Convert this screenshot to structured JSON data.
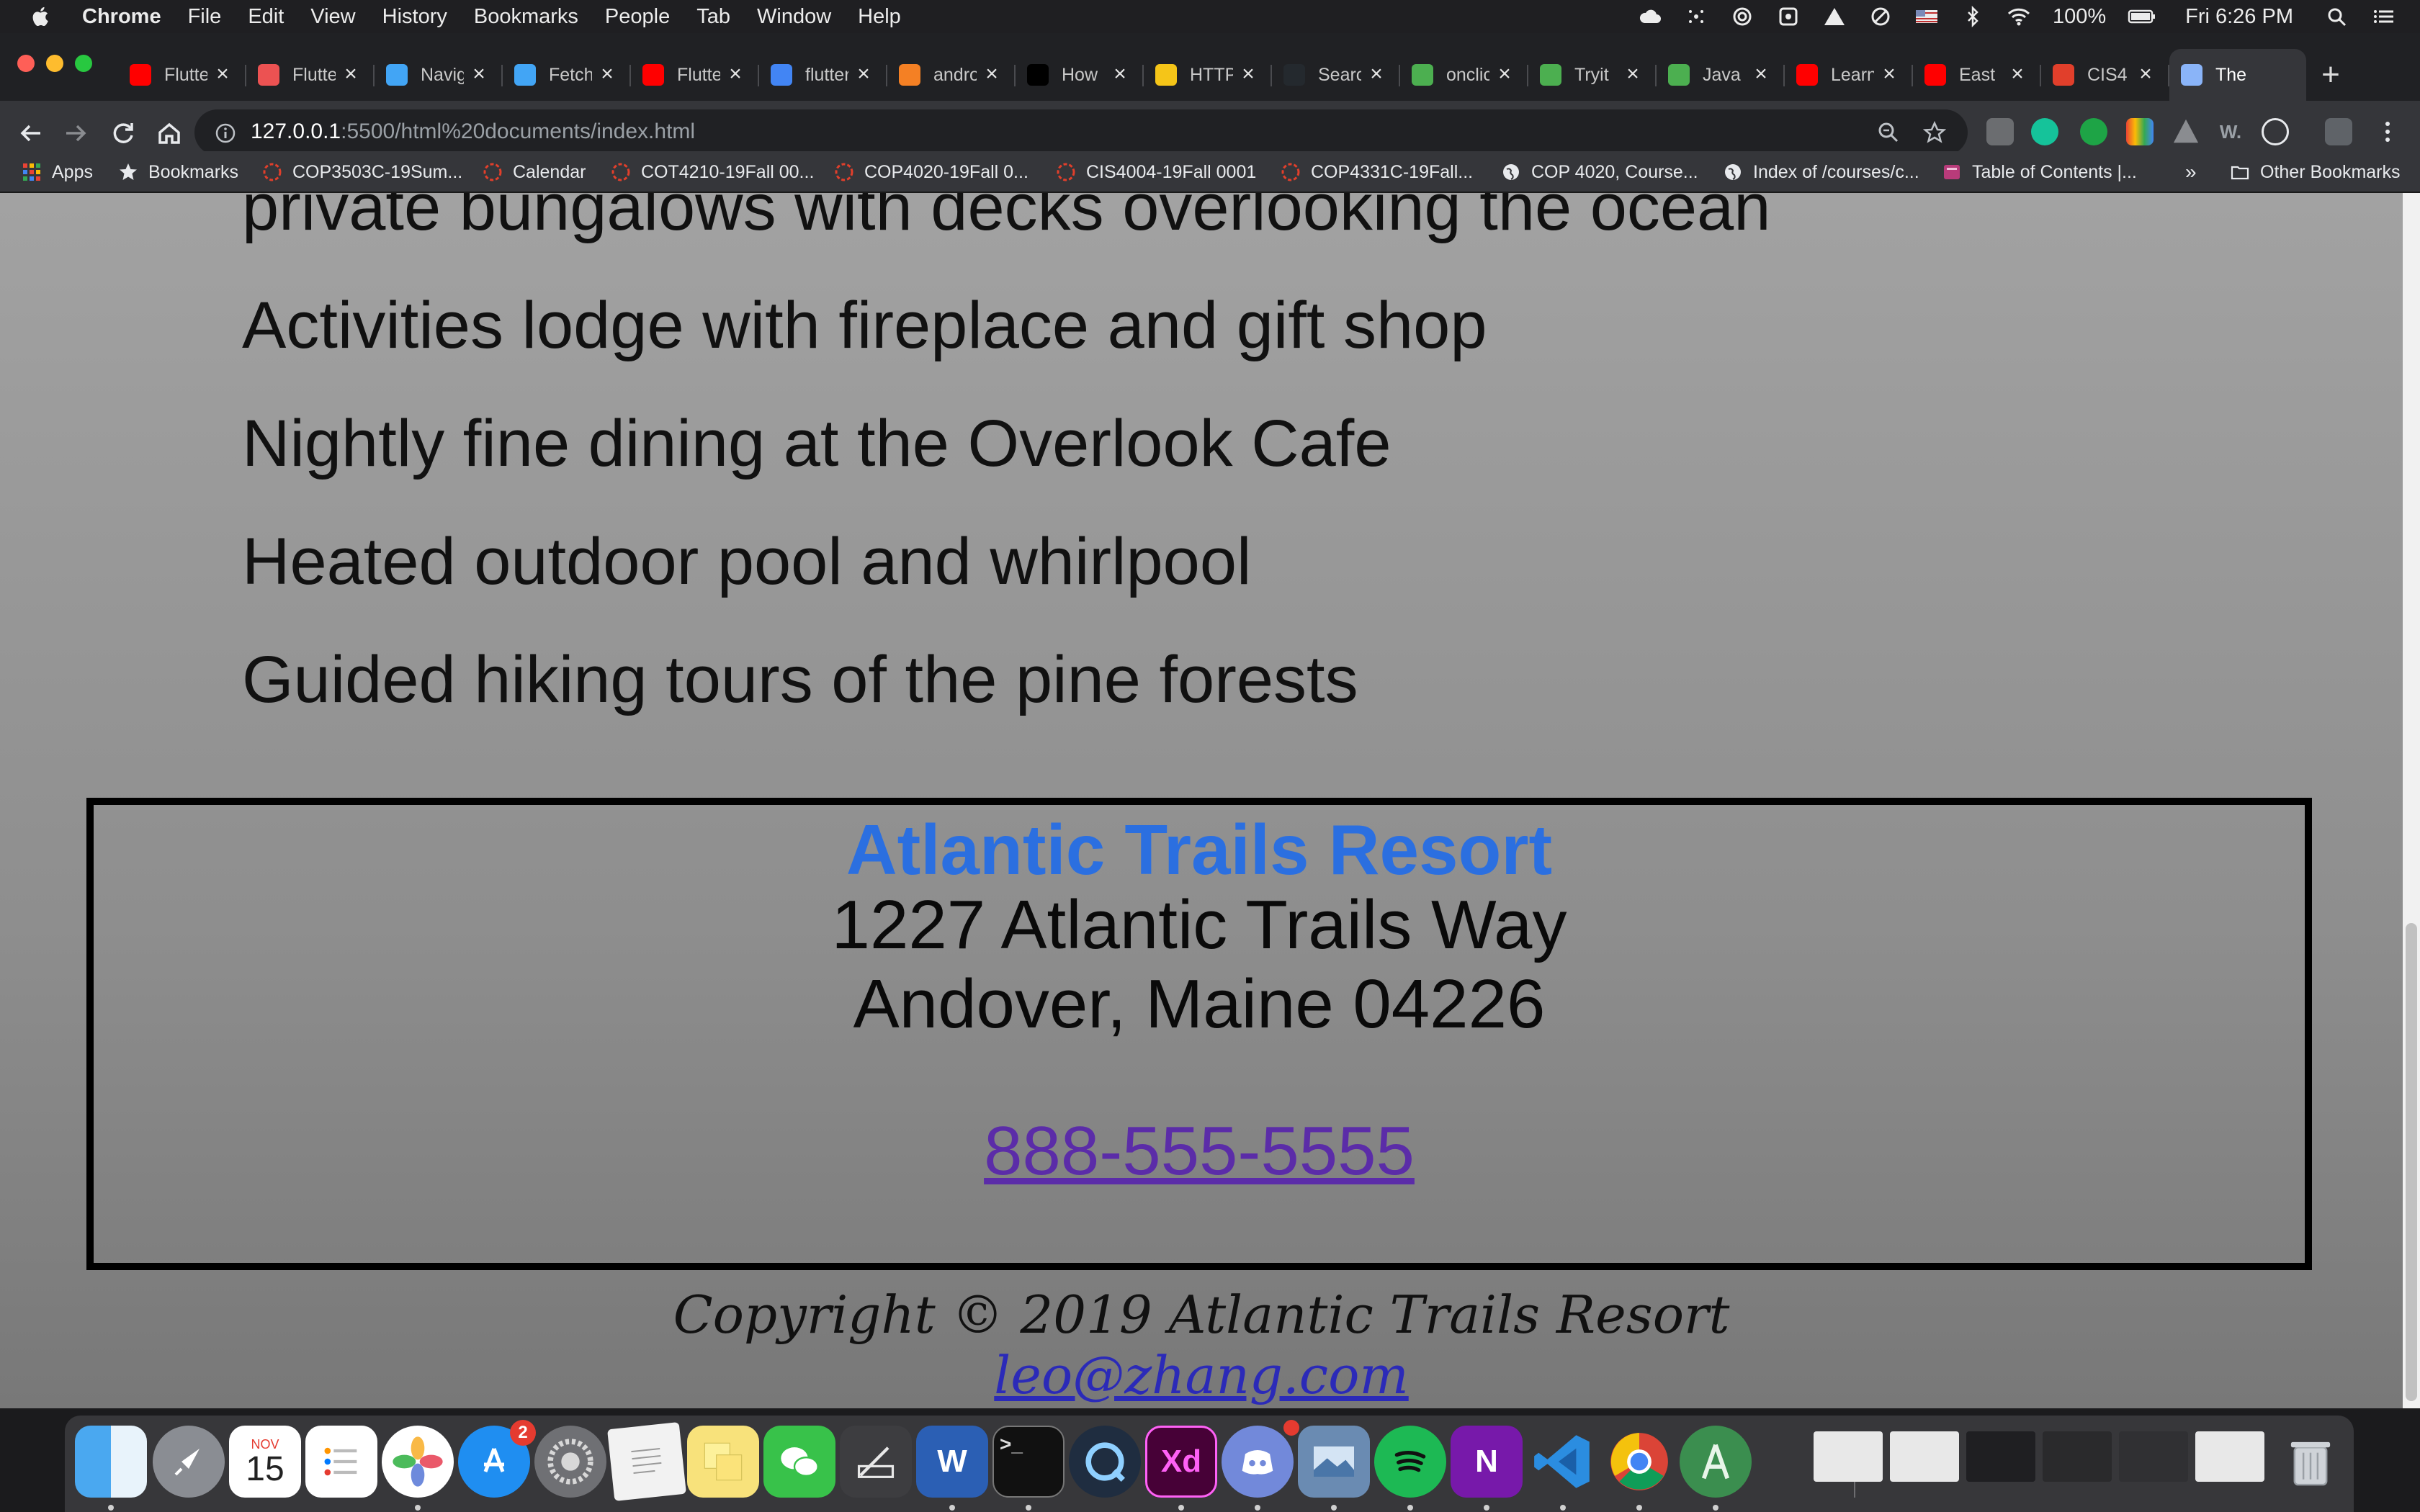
{
  "menubar": {
    "app_name": "Chrome",
    "menus": [
      "File",
      "Edit",
      "View",
      "History",
      "Bookmarks",
      "People",
      "Tab",
      "Window",
      "Help"
    ],
    "battery": "100%",
    "clock": "Fri 6:26 PM"
  },
  "tabs": [
    {
      "title": "Flutter",
      "icon": "youtube-icon",
      "color": "#ff0000"
    },
    {
      "title": "Flutter",
      "icon": "udemy-icon",
      "color": "#ec5252"
    },
    {
      "title": "Navigation",
      "icon": "flutter-icon",
      "color": "#42a5f5"
    },
    {
      "title": "Fetch",
      "icon": "flutter-icon",
      "color": "#42a5f5"
    },
    {
      "title": "Flutter",
      "icon": "youtube-icon",
      "color": "#ff0000"
    },
    {
      "title": "flutter",
      "icon": "google-icon",
      "color": "#4285f4"
    },
    {
      "title": "android",
      "icon": "stackoverflow-icon",
      "color": "#f48024"
    },
    {
      "title": "How",
      "icon": "medium-icon",
      "color": "#000000"
    },
    {
      "title": "HTTP",
      "icon": "http-cat-icon",
      "color": "#f5c518"
    },
    {
      "title": "Search",
      "icon": "github-icon",
      "color": "#24292e"
    },
    {
      "title": "onclick",
      "icon": "w3schools-icon",
      "color": "#4caf50"
    },
    {
      "title": "Tryit",
      "icon": "w3schools-icon",
      "color": "#4caf50"
    },
    {
      "title": "Java",
      "icon": "w3schools-icon",
      "color": "#4caf50"
    },
    {
      "title": "Learn",
      "icon": "youtube-icon",
      "color": "#ff0000"
    },
    {
      "title": "East",
      "icon": "youtube-icon",
      "color": "#ff0000"
    },
    {
      "title": "CIS4",
      "icon": "canvas-icon",
      "color": "#e13f2b"
    },
    {
      "title": "The",
      "icon": "page-icon",
      "color": "#8ab4f8"
    }
  ],
  "toolbar": {
    "url_host": "127.0.0.1",
    "url_rest": ":5500/html%20documents/index.html"
  },
  "bookmarks": [
    {
      "label": "Apps",
      "icon": "apps-grid-icon"
    },
    {
      "label": "Bookmarks",
      "icon": "star-icon"
    },
    {
      "label": "COP3503C-19Sum...",
      "icon": "canvas-icon"
    },
    {
      "label": "Calendar",
      "icon": "canvas-icon"
    },
    {
      "label": "COT4210-19Fall 00...",
      "icon": "canvas-icon"
    },
    {
      "label": "COP4020-19Fall 0...",
      "icon": "canvas-icon"
    },
    {
      "label": "CIS4004-19Fall 0001",
      "icon": "canvas-icon"
    },
    {
      "label": "COP4331C-19Fall...",
      "icon": "canvas-icon"
    },
    {
      "label": "COP 4020, Course...",
      "icon": "globe-icon"
    },
    {
      "label": "Index of /courses/c...",
      "icon": "globe-icon"
    },
    {
      "label": "Table of Contents |...",
      "icon": "book-icon"
    }
  ],
  "bookmarks_overflow": "»",
  "other_bookmarks": "Other Bookmarks",
  "page": {
    "features": [
      "private bungalows with decks overlooking the ocean",
      "Activities lodge with fireplace and gift shop",
      "Nightly fine dining at the Overlook Cafe",
      "Heated outdoor pool and whirlpool",
      "Guided hiking tours of the pine forests"
    ],
    "contact": {
      "name": "Atlantic Trails Resort",
      "address_line1": "1227 Atlantic Trails Way",
      "address_line2": "Andover, Maine 04226",
      "phone": "888-555-5555"
    },
    "copyright": "Copyright © 2019 Atlantic Trails Resort",
    "email": "leo@zhang.com"
  },
  "dock": {
    "calendar_month": "NOV",
    "calendar_day": "15",
    "app_store_badge": "2",
    "xd_label": "Xd",
    "word_label": "W",
    "onenote_label": "N"
  }
}
